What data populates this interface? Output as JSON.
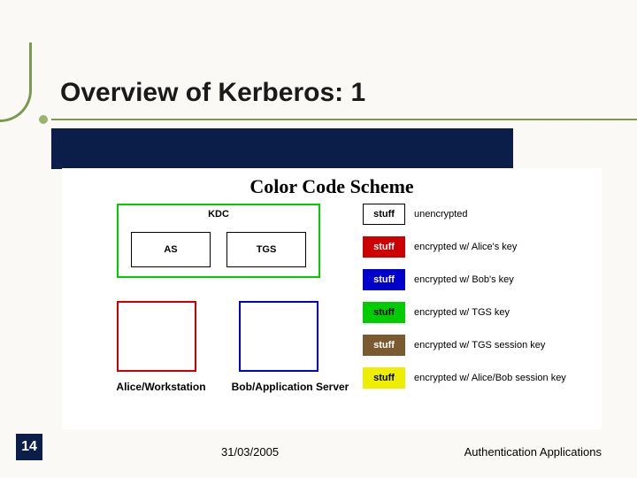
{
  "slide": {
    "title": "Overview of Kerberos: 1",
    "page_number": "14",
    "date": "31/03/2005",
    "topic": "Authentication Applications"
  },
  "diagram": {
    "scheme_title": "Color Code Scheme",
    "kdc_label": "KDC",
    "as_label": "AS",
    "tgs_label": "TGS",
    "alice_label": "Alice/Workstation",
    "bob_label": "Bob/Application Server",
    "legend": [
      {
        "swatch": "stuff",
        "text": "unencrypted"
      },
      {
        "swatch": "stuff",
        "text": "encrypted w/ Alice's key"
      },
      {
        "swatch": "stuff",
        "text": "encrypted w/ Bob's key"
      },
      {
        "swatch": "stuff",
        "text": "encrypted w/ TGS key"
      },
      {
        "swatch": "stuff",
        "text": "encrypted w/ TGS session key"
      },
      {
        "swatch": "stuff",
        "text": "encrypted w/ Alice/Bob session key"
      }
    ]
  }
}
